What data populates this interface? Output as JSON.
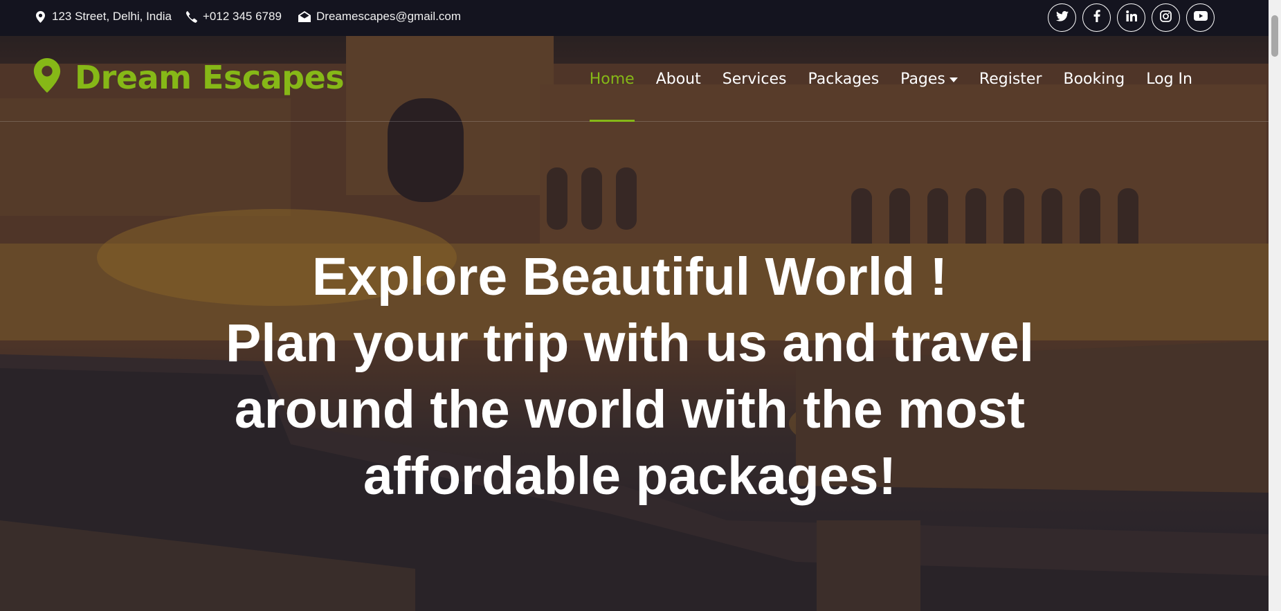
{
  "topbar": {
    "address": "123 Street, Delhi, India",
    "phone": "+012 345 6789",
    "email": "Dreamescapes@gmail.com",
    "socials": [
      "twitter-icon",
      "facebook-icon",
      "linkedin-icon",
      "instagram-icon",
      "youtube-icon"
    ]
  },
  "brand": {
    "name": "Dream Escapes",
    "color": "#86b817"
  },
  "nav": {
    "items": [
      {
        "label": "Home",
        "active": true
      },
      {
        "label": "About"
      },
      {
        "label": "Services"
      },
      {
        "label": "Packages"
      },
      {
        "label": "Pages",
        "dropdown": true
      },
      {
        "label": "Register"
      },
      {
        "label": "Booking"
      },
      {
        "label": "Log In"
      }
    ]
  },
  "hero": {
    "lines": [
      "Explore Beautiful World !",
      "Plan your trip with us and travel",
      "around the world with the most",
      "affordable packages!"
    ]
  },
  "colors": {
    "accent": "#86b817",
    "topbar_bg": "#14141f"
  }
}
